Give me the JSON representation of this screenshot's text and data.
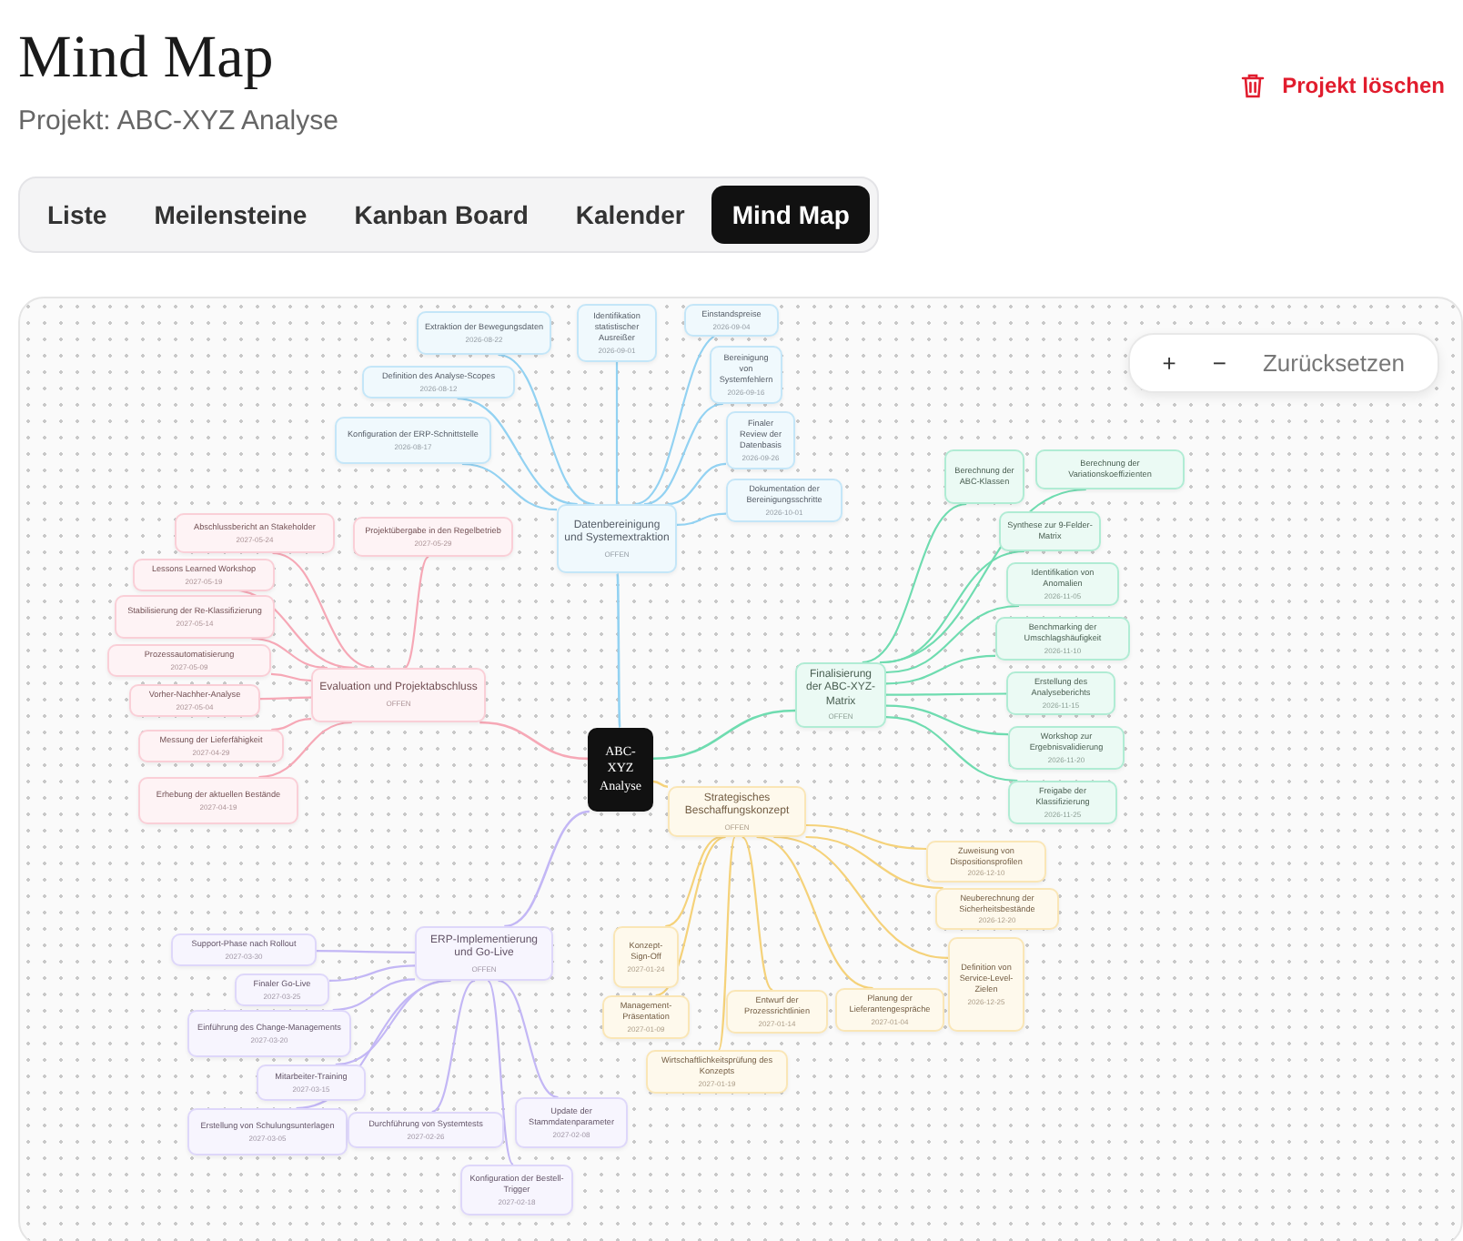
{
  "header": {
    "title": "Mind Map",
    "subtitle": "Projekt: ABC-XYZ Analyse",
    "delete_action": "Projekt löschen"
  },
  "tabs": [
    {
      "label": "Liste",
      "selected": false
    },
    {
      "label": "Meilensteine",
      "selected": false
    },
    {
      "label": "Kanban Board",
      "selected": false
    },
    {
      "label": "Kalender",
      "selected": false
    },
    {
      "label": "Mind Map",
      "selected": true
    }
  ],
  "zoom_controls": [
    "+",
    "−",
    "Zurücksetzen"
  ],
  "mind_map": {
    "center": {
      "label": "ABC-XYZ Analyse"
    },
    "branches": [
      {
        "title": "Datenbereinigung und Systemextraktion",
        "status": "OFFEN",
        "color": "#93d2f2",
        "children": [
          {
            "title": "Extraktion der Bewegungsdaten",
            "date": "2026-08-22"
          },
          {
            "title": "Definition des Analyse-Scopes",
            "date": "2026-08-12"
          },
          {
            "title": "Konfiguration der ERP-Schnittstelle",
            "date": "2026-08-17"
          },
          {
            "title": "Identifikation statistischer Ausreißer",
            "date": "2026-09-01"
          },
          {
            "title": "Einstandspreise",
            "date": "2026-09-04"
          },
          {
            "title": "Bereinigung von Systemfehlern",
            "date": "2026-09-16"
          },
          {
            "title": "Finaler Review der Datenbasis",
            "date": "2026-09-26"
          },
          {
            "title": "Dokumentation der Bereinigungsschritte",
            "date": "2026-10-01"
          }
        ]
      },
      {
        "title": "Evaluation und Projektabschluss",
        "status": "OFFEN",
        "color": "#f6a8b6",
        "children": [
          {
            "title": "Abschlussbericht an Stakeholder",
            "date": "2027-05-24"
          },
          {
            "title": "Projektübergabe in den Regelbetrieb",
            "date": "2027-05-29"
          },
          {
            "title": "Lessons Learned Workshop",
            "date": "2027-05-19"
          },
          {
            "title": "Stabilisierung der Re-Klassifizierung",
            "date": "2027-05-14"
          },
          {
            "title": "Prozessautomatisierung",
            "date": "2027-05-09"
          },
          {
            "title": "Vorher-Nachher-Analyse",
            "date": "2027-05-04"
          },
          {
            "title": "Messung der Lieferfähigkeit",
            "date": "2027-04-29"
          },
          {
            "title": "Erhebung der aktuellen Bestände",
            "date": "2027-04-19"
          }
        ]
      },
      {
        "title": "Finalisierung der ABC-XYZ-Matrix",
        "status": "OFFEN",
        "color": "#6fdcb0",
        "children": [
          {
            "title": "Berechnung der ABC-Klassen"
          },
          {
            "title": "Berechnung der Variationskoeffizienten"
          },
          {
            "title": "Synthese zur 9-Felder-Matrix"
          },
          {
            "title": "Identifikation von Anomalien",
            "date": "2026-11-05"
          },
          {
            "title": "Benchmarking der Umschlagshäufigkeit",
            "date": "2026-11-10"
          },
          {
            "title": "Erstellung des Analyseberichts",
            "date": "2026-11-15"
          },
          {
            "title": "Workshop zur Ergebnisvalidierung",
            "date": "2026-11-20"
          },
          {
            "title": "Freigabe der Klassifizierung",
            "date": "2026-11-25"
          }
        ]
      },
      {
        "title": "Strategisches Beschaffungskonzept",
        "status": "OFFEN",
        "color": "#f5d27a",
        "children": [
          {
            "title": "Zuweisung von Dispositionsprofilen",
            "date": "2026-12-10"
          },
          {
            "title": "Neuberechnung der Sicherheitsbestände",
            "date": "2026-12-20"
          },
          {
            "title": "Konzept-Sign-Off",
            "date": "2027-01-24"
          },
          {
            "title": "Definition von Service-Level-Zielen",
            "date": "2026-12-25"
          },
          {
            "title": "Management-Präsentation",
            "date": "2027-01-09"
          },
          {
            "title": "Entwurf der Prozessrichtlinien",
            "date": "2027-01-14"
          },
          {
            "title": "Planung der Lieferantengespräche",
            "date": "2027-01-04"
          },
          {
            "title": "Wirtschaftlichkeitsprüfung des Konzepts",
            "date": "2027-01-19"
          }
        ]
      },
      {
        "title": "ERP-Implementierung und Go-Live",
        "status": "OFFEN",
        "color": "#c3b7f5",
        "children": [
          {
            "title": "Support-Phase nach Rollout",
            "date": "2027-03-30"
          },
          {
            "title": "Finaler Go-Live",
            "date": "2027-03-25"
          },
          {
            "title": "Einführung des Change-Managements",
            "date": "2027-03-20"
          },
          {
            "title": "Mitarbeiter-Training",
            "date": "2027-03-15"
          },
          {
            "title": "Erstellung von Schulungsunterlagen",
            "date": "2027-03-05"
          },
          {
            "title": "Durchführung von Systemtests",
            "date": "2027-02-26"
          },
          {
            "title": "Konfiguration der Bestell-Trigger",
            "date": "2027-02-18"
          },
          {
            "title": "Update der Stammdatenparameter",
            "date": "2027-02-08"
          }
        ]
      }
    ]
  }
}
